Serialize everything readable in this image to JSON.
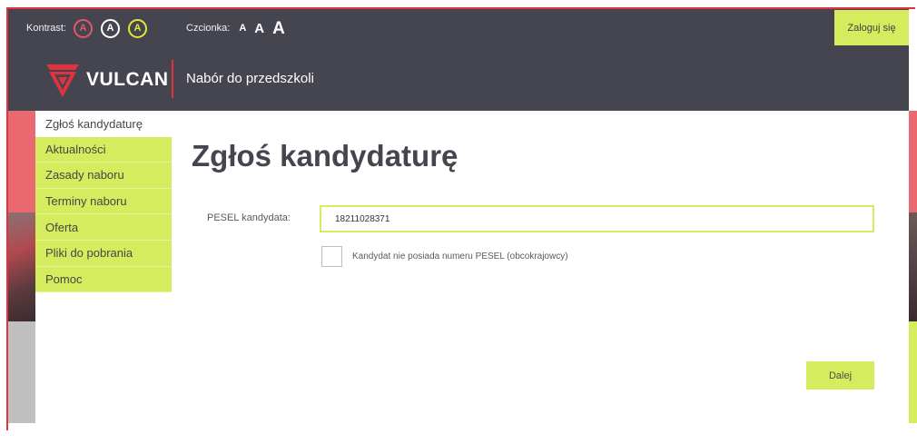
{
  "header": {
    "contrast_label": "Kontrast:",
    "contrast_options": [
      "A",
      "A",
      "A"
    ],
    "font_label": "Czcionka:",
    "font_options": [
      "A",
      "A",
      "A"
    ],
    "login_label": "Zaloguj się",
    "logo_text": "VULCAN",
    "app_title": "Nabór do przedszkoli"
  },
  "sidebar": {
    "items": [
      {
        "label": "Zgłoś kandydaturę",
        "active": true
      },
      {
        "label": "Aktualności"
      },
      {
        "label": "Zasady naboru"
      },
      {
        "label": "Terminy naboru"
      },
      {
        "label": "Oferta"
      },
      {
        "label": "Pliki do pobrania"
      },
      {
        "label": "Pomoc"
      }
    ]
  },
  "main": {
    "title": "Zgłoś kandydaturę",
    "pesel_label": "PESEL kandydata:",
    "pesel_value": "18211028371",
    "no_pesel_label": "Kandydat nie posiada numeru PESEL (obcokrajowcy)",
    "no_pesel_checked": false,
    "next_label": "Dalej"
  },
  "colors": {
    "header_bg": "#454550",
    "accent_green": "#d5ec5e",
    "accent_red": "#e2323f",
    "contrast_red": "#e2586a",
    "contrast_yellow": "#e7e63c"
  }
}
